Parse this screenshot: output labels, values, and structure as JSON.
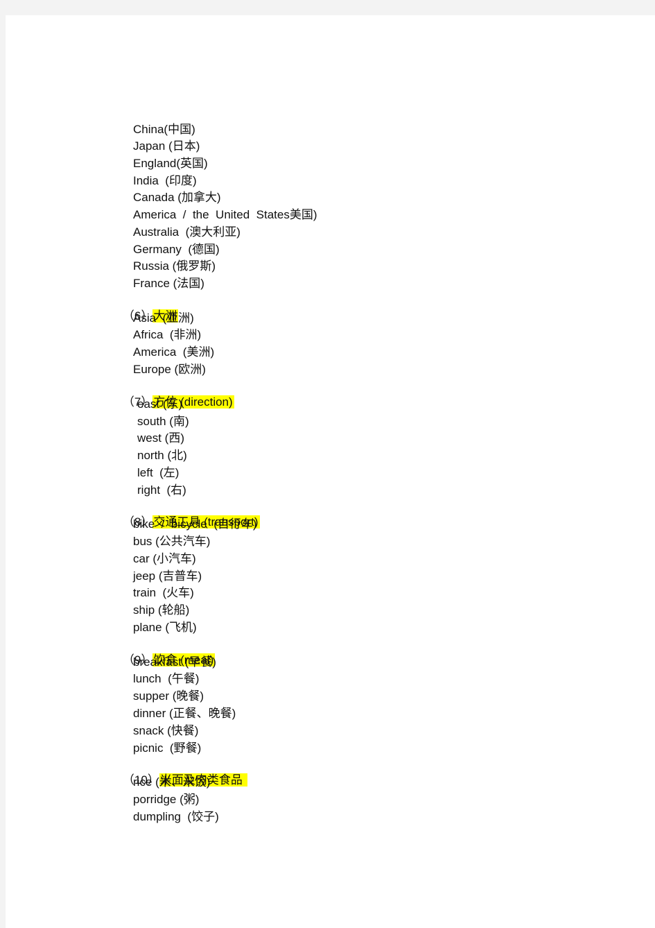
{
  "document": {
    "countries": [
      "China(中国)",
      "Japan (日本)",
      "England(英国)",
      "India  (印度)",
      "Canada (加拿大)",
      "America  /  the  United  States美国)",
      "Australia  (澳大利亚)",
      "Germany  (德国)",
      "Russia (俄罗斯)",
      "France (法国)"
    ],
    "sections": [
      {
        "number": "（6）",
        "title": "大洲",
        "items": [
          "Asia  (亚洲)",
          "Africa  (非洲)",
          "America  (美洲)",
          "Europe (欧洲)"
        ]
      },
      {
        "number": "（7）",
        "title": "方位 (direction)",
        "items": [
          "east (东)",
          "south (南)",
          "west (西)",
          "north (北)",
          "left  (左)",
          "right  (右)"
        ]
      },
      {
        "number": "（8）",
        "title": "交通工具 (transport)",
        "items": [
          "bike  /  bicycle  (自行车)",
          "bus (公共汽车)",
          "car (小汽车)",
          "jeep (吉普车)",
          "train  (火车)",
          "ship (轮船)",
          "plane (飞机)"
        ]
      },
      {
        "number": "（9）",
        "title": "饮食 (meal)",
        "items": [
          "breakfast (早餐)",
          "lunch  (午餐)",
          "supper (晚餐)",
          "dinner (正餐、晚餐)",
          "snack (快餐)",
          "picnic  (野餐)"
        ]
      },
      {
        "number": "（10）",
        "title": "米面及肉类食品 ",
        "items": [
          "rice (米、米饭)",
          "porridge (粥)",
          "dumpling  (饺子)"
        ]
      }
    ]
  }
}
